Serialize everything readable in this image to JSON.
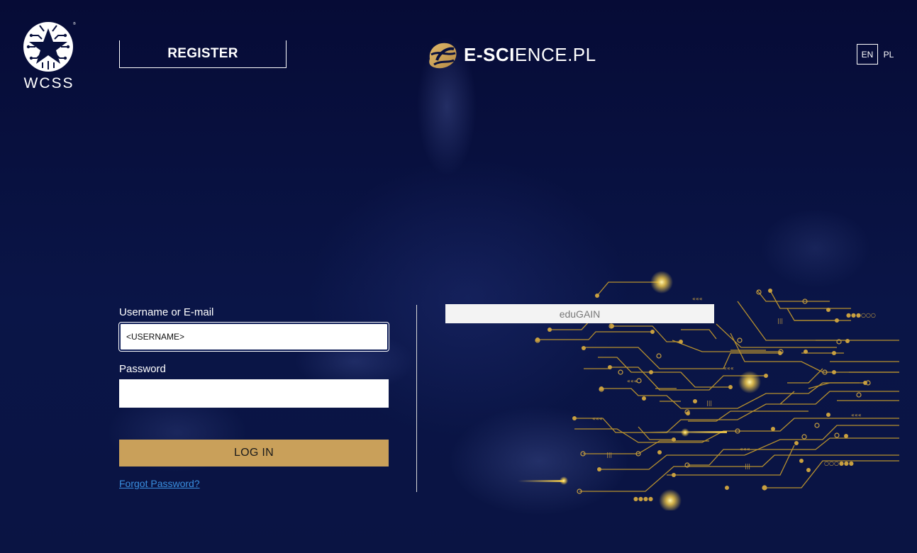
{
  "header": {
    "org_logo_text": "WCSS",
    "register_label": "REGISTER",
    "brand_bold": "E-SCI",
    "brand_light": "ENCE.PL",
    "languages": [
      "EN",
      "PL"
    ]
  },
  "login": {
    "username_label": "Username or E-mail",
    "username_value": "<USERNAME>",
    "password_label": "Password",
    "password_value": "",
    "submit_label": "LOG IN",
    "forgot_label": "Forgot Password?"
  },
  "federated": {
    "edugain_label": "eduGAIN"
  },
  "colors": {
    "background": "#08103d",
    "accent_gold": "#c9a05a",
    "link_blue": "#3a8fe0"
  },
  "icons": {
    "org_logo": "wcss-star-logo-icon",
    "brand_logo": "e-science-mark-icon",
    "decoration": "circuit-board-graphic"
  }
}
